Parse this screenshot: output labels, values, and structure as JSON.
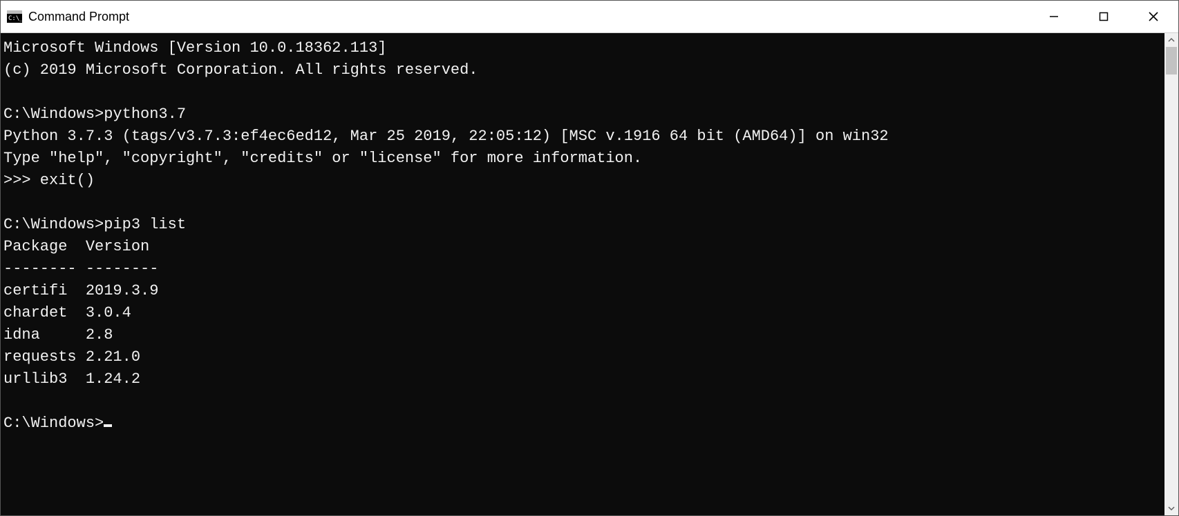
{
  "titlebar": {
    "title": "Command Prompt"
  },
  "terminal": {
    "lines": [
      "Microsoft Windows [Version 10.0.18362.113]",
      "(c) 2019 Microsoft Corporation. All rights reserved.",
      "",
      "C:\\Windows>python3.7",
      "Python 3.7.3 (tags/v3.7.3:ef4ec6ed12, Mar 25 2019, 22:05:12) [MSC v.1916 64 bit (AMD64)] on win32",
      "Type \"help\", \"copyright\", \"credits\" or \"license\" for more information.",
      ">>> exit()",
      "",
      "C:\\Windows>pip3 list",
      "Package  Version",
      "-------- --------",
      "certifi  2019.3.9",
      "chardet  3.0.4",
      "idna     2.8",
      "requests 2.21.0",
      "urllib3  1.24.2",
      "",
      "C:\\Windows>"
    ]
  }
}
